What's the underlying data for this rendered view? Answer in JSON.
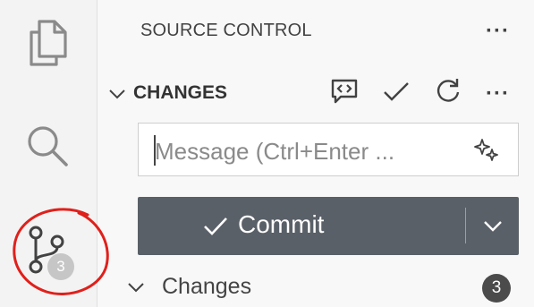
{
  "panel": {
    "title": "SOURCE CONTROL",
    "more": "···"
  },
  "changes": {
    "header": "CHANGES",
    "more": "···",
    "message_placeholder": "Message (Ctrl+Enter ...",
    "commit_label": "Commit",
    "group_label": "Changes",
    "group_count": "3"
  },
  "activity_bar": {
    "scm_badge": "3"
  },
  "icons": [
    "explorer-icon",
    "search-icon",
    "source-control-icon",
    "view-as-tree-icon",
    "commit-check-icon",
    "refresh-icon",
    "sparkle-icon",
    "chevron-down-icon",
    "chevron-right-icon"
  ],
  "colors": {
    "commit_button": "#5a6068",
    "annotation_circle": "#e0201b",
    "count_badge": "#4b4b4b"
  }
}
